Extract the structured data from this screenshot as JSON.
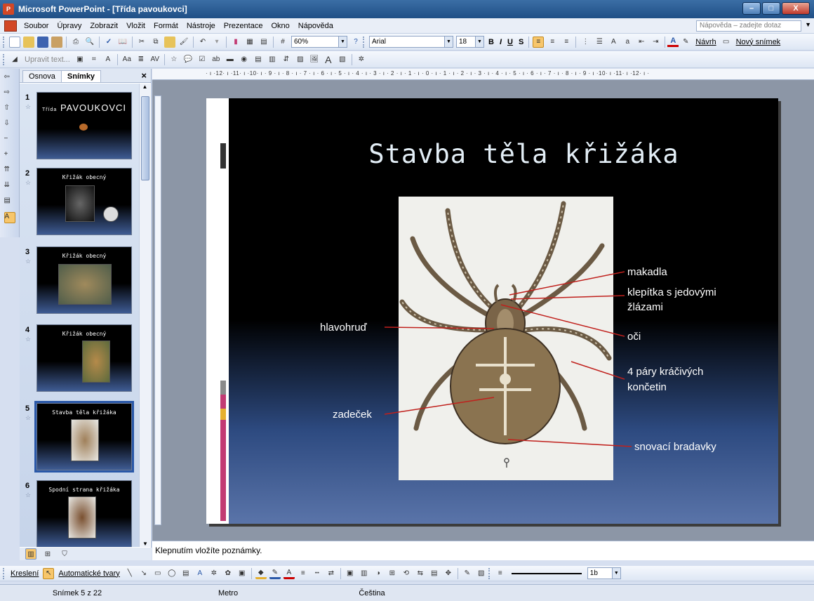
{
  "window": {
    "title": "Microsoft PowerPoint - [Třída pavoukovci]",
    "controls": {
      "minimize": "–",
      "maximize": "□",
      "close": "X"
    }
  },
  "menubar": {
    "items": [
      "Soubor",
      "Úpravy",
      "Zobrazit",
      "Vložit",
      "Formát",
      "Nástroje",
      "Prezentace",
      "Okno",
      "Nápověda"
    ],
    "help_placeholder": "Nápověda – zadejte dotaz"
  },
  "toolbar_standard": {
    "zoom": "60%",
    "font": "Arial",
    "font_size": "18",
    "bold": "B",
    "italic": "I",
    "underline": "U",
    "shadow": "S",
    "design_label": "Návrh",
    "new_slide_label": "Nový snímek",
    "font_color_glyph": "A"
  },
  "toolbar_review": {
    "edit_text_label": "Upravit text..."
  },
  "slides_pane": {
    "tabs": [
      "Osnova",
      "Snímky"
    ],
    "active_tab": "Snímky",
    "close_glyph": "×",
    "slides": [
      {
        "number": "1",
        "title": "PAVOUKOVCI",
        "subtitle": "Třída"
      },
      {
        "number": "2",
        "title": "Křižák obecný"
      },
      {
        "number": "3",
        "title": "Křižák obecný"
      },
      {
        "number": "4",
        "title": "Křižák obecný"
      },
      {
        "number": "5",
        "title": "Stavba těla křižáka"
      },
      {
        "number": "6",
        "title": "Spodní strana křižáka"
      }
    ],
    "selected_slide": 5
  },
  "ruler": {
    "h_ticks": "· ı ·12· ı ·11· ı ·10· ı · 9 · ı · 8 · ı · 7 · ı · 6 · ı · 5 · ı · 4 · ı · 3 · ı · 2 · ı · 1 · ı · 0 · ı · 1 · ı · 2 · ı · 3 · ı · 4 · ı · 5 · ı · 6 · ı · 7 · ı · 8 · ı · 9 · ı ·10· ı ·11· ı ·12· ı ·"
  },
  "slide": {
    "title": "Stavba těla křižáka",
    "labels": {
      "makadla": "makadla",
      "klepitka_1": "klepítka s jedovými",
      "klepitka_2": "žlázami",
      "oci": "oči",
      "hlavohrud": "hlavohruď",
      "nohy_1": "4 páry kráčivých",
      "nohy_2": "končetin",
      "zadecek": "zadeček",
      "snovaci": "snovací bradavky"
    }
  },
  "notes": {
    "placeholder": "Klepnutím vložíte poznámky."
  },
  "drawing_toolbar": {
    "draw_label": "Kreslení",
    "autoshapes_label": "Automatické tvary",
    "line_width": "1b"
  },
  "statusbar": {
    "slide_position": "Snímek 5 z 22",
    "design": "Metro",
    "language": "Čeština"
  },
  "colors": {
    "arrow": "#c0201c",
    "title_text": "#e3eef6"
  }
}
